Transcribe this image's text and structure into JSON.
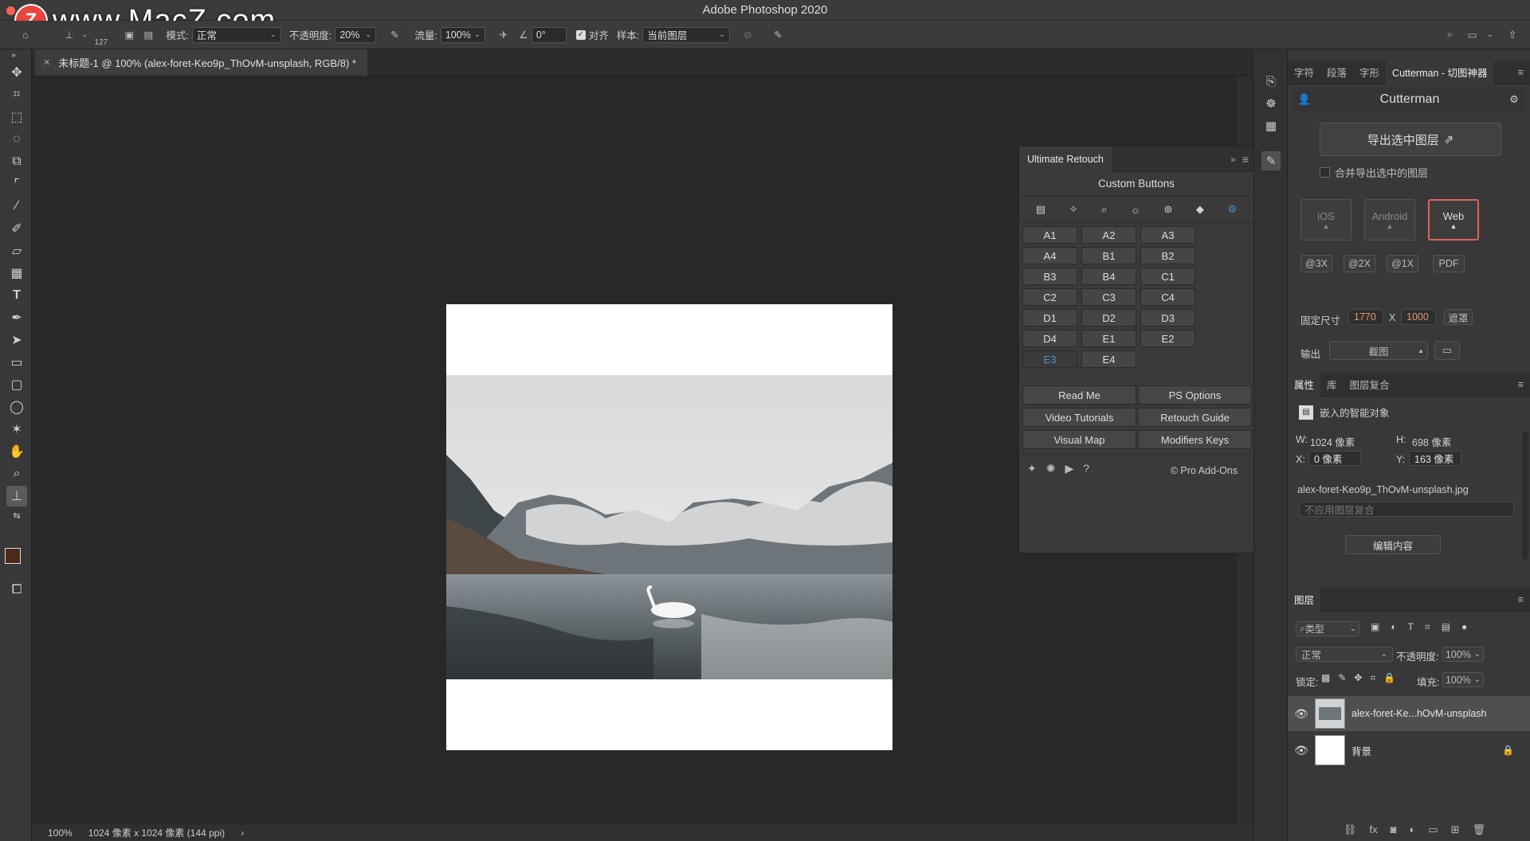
{
  "app": {
    "title": "Adobe Photoshop 2020",
    "watermark": "www.MacZ.com",
    "watermark_logo": "Z"
  },
  "options": {
    "brush_size": "127",
    "mode_label": "模式:",
    "mode_value": "正常",
    "opacity_label": "不透明度:",
    "opacity_value": "20%",
    "flow_label": "流量:",
    "flow_value": "100%",
    "angle_value": "0°",
    "align_label": "对齐",
    "sample_label": "样本:",
    "sample_value": "当前图层"
  },
  "document": {
    "tab_title": "未标题-1 @ 100% (alex-foret-Keo9p_ThOvM-unsplash, RGB/8) *",
    "zoom": "100%",
    "info": "1024 像素 x 1024 像素 (144 ppi)"
  },
  "ultimate_retouch": {
    "tab": "Ultimate Retouch",
    "subtitle": "Custom Buttons",
    "grid": [
      "A1",
      "A2",
      "A3",
      "A4",
      "B1",
      "B2",
      "B3",
      "B4",
      "C1",
      "C2",
      "C3",
      "C4",
      "D1",
      "D2",
      "D3",
      "D4",
      "E1",
      "E2",
      "E3",
      "E4"
    ],
    "selected": "E3",
    "big_buttons": [
      "Read Me",
      "PS Options",
      "Video Tutorials",
      "Retouch Guide",
      "Visual Map",
      "Modifiers Keys"
    ],
    "credit": "© Pro Add-Ons"
  },
  "cutterman": {
    "tabs": [
      "字符",
      "段落",
      "字形",
      "Cutterman - 切图神器"
    ],
    "title": "Cutterman",
    "export_btn": "导出选中图层",
    "merge_label": "合并导出选中的图层",
    "platforms": [
      "iOS",
      "Android",
      "Web"
    ],
    "active_platform": "Web",
    "scales": [
      "@3X",
      "@2X",
      "@1X",
      "PDF"
    ],
    "fixed_label": "固定尺寸",
    "width": "1770",
    "x": "X",
    "height": "1000",
    "mask_btn": "遮罩",
    "output_label": "输出",
    "output_value": "截图"
  },
  "properties": {
    "tabs": [
      "属性",
      "库",
      "图层复合"
    ],
    "type": "嵌入的智能对象",
    "w_label": "W:",
    "w_value": "1024 像素",
    "h_label": "H:",
    "h_value": "698 像素",
    "x_label": "X:",
    "x_value": "0 像素",
    "y_label": "Y:",
    "y_value": "163 像素",
    "filename": "alex-foret-Keo9p_ThOvM-unsplash.jpg",
    "comp_placeholder": "不应用图层复合",
    "edit_btn": "编辑内容"
  },
  "layers": {
    "tab": "图层",
    "filter": "类型",
    "blend": "正常",
    "opacity_label": "不透明度:",
    "opacity_value": "100%",
    "lock_label": "锁定:",
    "fill_label": "填充:",
    "fill_value": "100%",
    "items": [
      {
        "name": "alex-foret-Ke...hOvM-unsplash"
      },
      {
        "name": "背景"
      }
    ]
  }
}
